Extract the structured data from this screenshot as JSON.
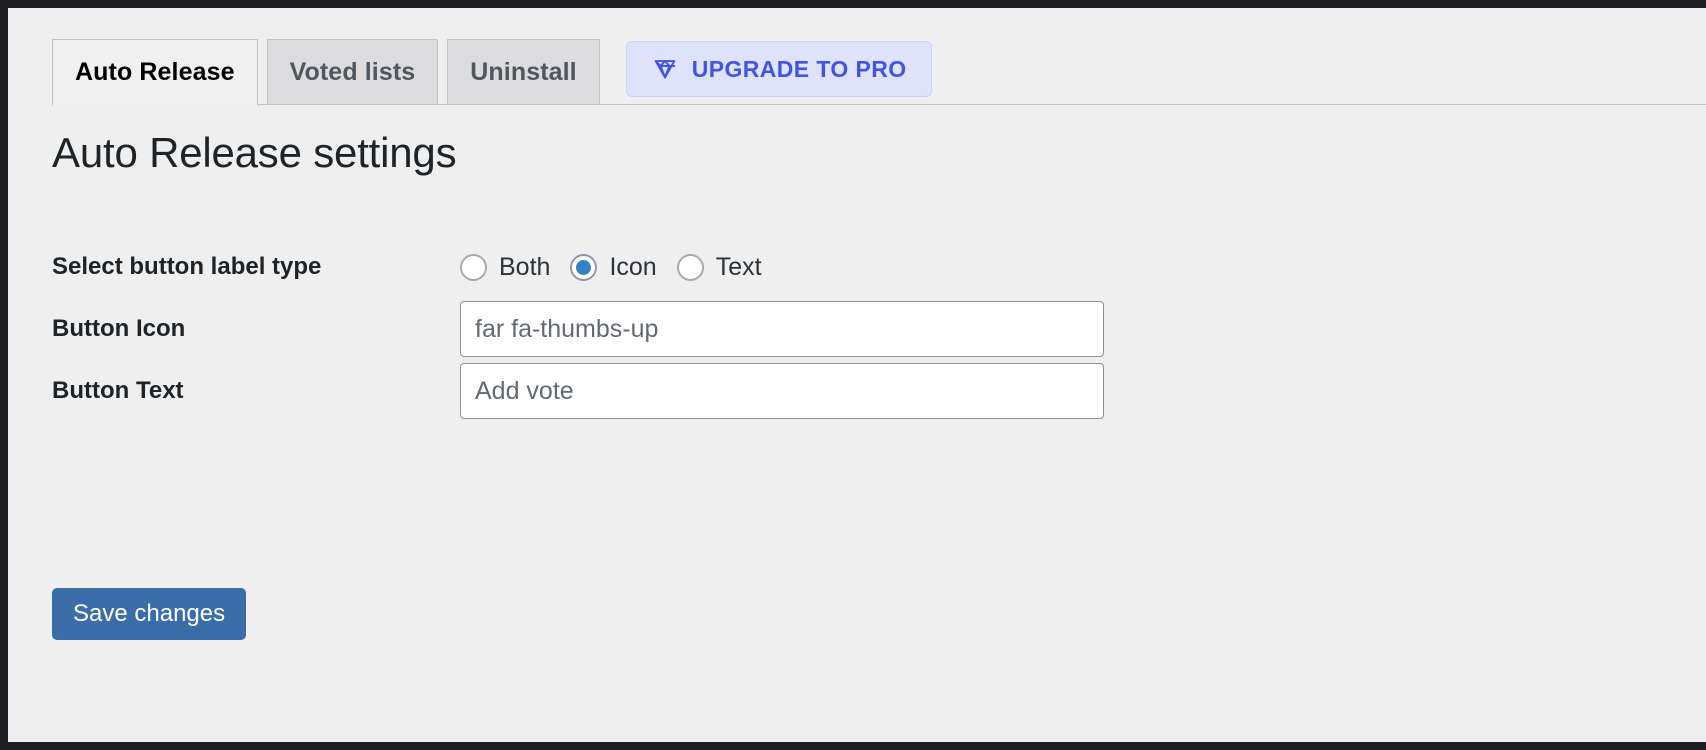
{
  "theme": {
    "page_bg": "#efeff0",
    "active_tab_bg": "#f0f0f1",
    "inactive_tab_bg": "#dcdcde",
    "border": "#c3c4c7",
    "upgrade_bg": "#dfe2fb",
    "upgrade_fg": "#4355e0",
    "radio_accent": "#3582c4",
    "save_btn_bg": "#3b6ea8",
    "heading_color": "#1d2327"
  },
  "tabs": [
    {
      "label": "Auto Release",
      "active": true
    },
    {
      "label": "Voted lists",
      "active": false
    },
    {
      "label": "Uninstall",
      "active": false
    }
  ],
  "upgrade": {
    "label": "UPGRADE TO PRO",
    "icon": "gem-diamond-icon"
  },
  "heading": "Auto Release settings",
  "fields": {
    "label_type": {
      "label": "Select button label type",
      "options": [
        {
          "value": "both",
          "label": "Both",
          "checked": false
        },
        {
          "value": "icon",
          "label": "Icon",
          "checked": true
        },
        {
          "value": "text",
          "label": "Text",
          "checked": false
        }
      ]
    },
    "button_icon": {
      "label": "Button Icon",
      "value": "far fa-thumbs-up",
      "placeholder": "far fa-thumbs-up"
    },
    "button_text": {
      "label": "Button Text",
      "value": "Add vote",
      "placeholder": "Add vote"
    }
  },
  "actions": {
    "save_label": "Save changes"
  }
}
